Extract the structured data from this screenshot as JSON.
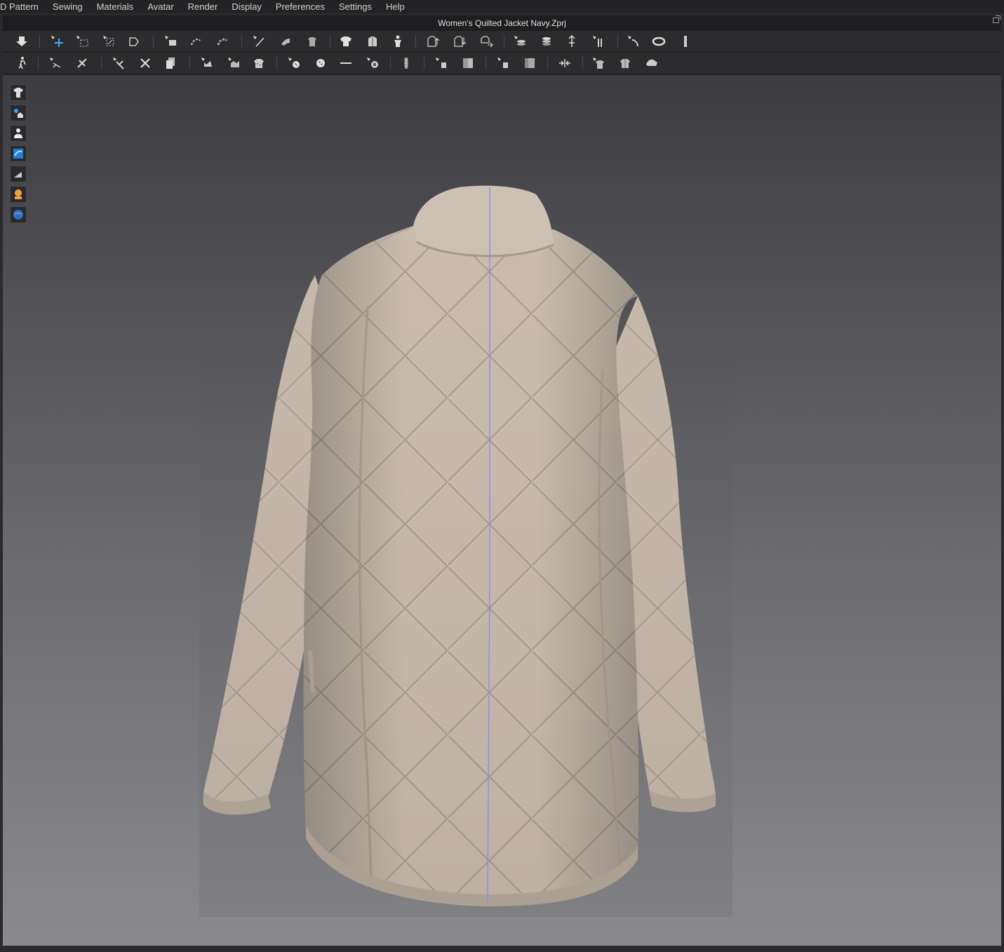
{
  "menu": {
    "items": [
      "D Pattern",
      "Sewing",
      "Materials",
      "Avatar",
      "Render",
      "Display",
      "Preferences",
      "Settings",
      "Help"
    ]
  },
  "window": {
    "title": "Women's Quilted Jacket Navy.Zprj"
  },
  "toolbar_top": {
    "tools": [
      "simulation-icon",
      "select-mesh-icon",
      "box-select-icon",
      "transform-pattern-icon",
      "fold-icon",
      "fold-arrangement-icon",
      "layer-icon",
      "tack-icon",
      "pin-icon",
      "brush-icon",
      "shirt-show-icon",
      "shirt-hide-icon",
      "avatar-show-icon",
      "garment-up-icon",
      "garment-down-icon",
      "garment-sync-icon",
      "strengthen-icon",
      "stack-icon",
      "measure-pin-icon",
      "split-icon",
      "tape-icon",
      "ring-icon",
      "ruler-icon"
    ]
  },
  "toolbar_bottom": {
    "tools": [
      "pose-icon",
      "sewing-icon",
      "segment-sewing-icon",
      "trim-icon",
      "cut-icon",
      "copy-icon",
      "fabric-icon",
      "puckering-icon",
      "texture-icon",
      "button-icon",
      "button-hole-icon",
      "line-icon",
      "lock-button-icon",
      "zipper-icon",
      "piping-icon",
      "graphic-icon",
      "trim-piece-icon",
      "shade-icon",
      "pull-icon",
      "tuck-icon",
      "fitting-icon",
      "shoe-icon"
    ]
  },
  "viewport": {
    "side_tools": [
      "garment-display-icon",
      "texture-display-icon",
      "avatar-display-icon",
      "fabric-display-icon",
      "pattern-display-icon",
      "skin-display-icon",
      "environment-display-icon"
    ],
    "garment_color": "#c9bcae",
    "seam_line_color": "#8a8cf0"
  }
}
